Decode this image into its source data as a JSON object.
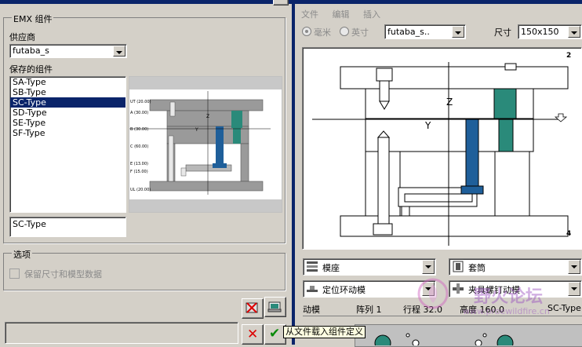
{
  "left": {
    "emx_group": "EMX 组件",
    "supplier_label": "供应商",
    "supplier_value": "futaba_s",
    "saved_label": "保存的组件",
    "saved_items": [
      "SA-Type",
      "SB-Type",
      "SC-Type",
      "SD-Type",
      "SE-Type",
      "SF-Type"
    ],
    "selected_index": 2,
    "name_value": "SC-Type",
    "options_group": "选项",
    "keep_checkbox": "保留尺寸和模型数据",
    "tooltip": "从文件载入组件定义",
    "preview_labels": [
      "UT (20.00)",
      "A (30.00)",
      "B (30.00)",
      "C (60.00)",
      "E (13.00)",
      "F (15.00)",
      "UL (20.00)"
    ],
    "preview_axis": [
      "Z",
      "Y"
    ]
  },
  "right": {
    "menu": [
      "文件",
      "编辑",
      "插入"
    ],
    "unit_mm": "毫米",
    "unit_inch": "英寸",
    "vendor_value": "futaba_s..",
    "size_label": "尺寸",
    "size_value": "150x150",
    "axis_z": "Z",
    "axis_y": "Y",
    "corner_tr": "2",
    "corner_br": "4",
    "combos": [
      {
        "label": "模座"
      },
      {
        "label": "套筒"
      },
      {
        "label": "定位环动模"
      },
      {
        "label": "夹具螺钉动模"
      }
    ],
    "status": [
      "动模",
      "阵列 1",
      "行程 32.0",
      "高度 160.0",
      "SC-Type"
    ],
    "watermark": "野火论坛",
    "watermark_url": "www.proewildfire.cn"
  },
  "colors": {
    "teal": "#2a8a7a",
    "blue": "#1f5f9a",
    "select": "#0a246a"
  }
}
